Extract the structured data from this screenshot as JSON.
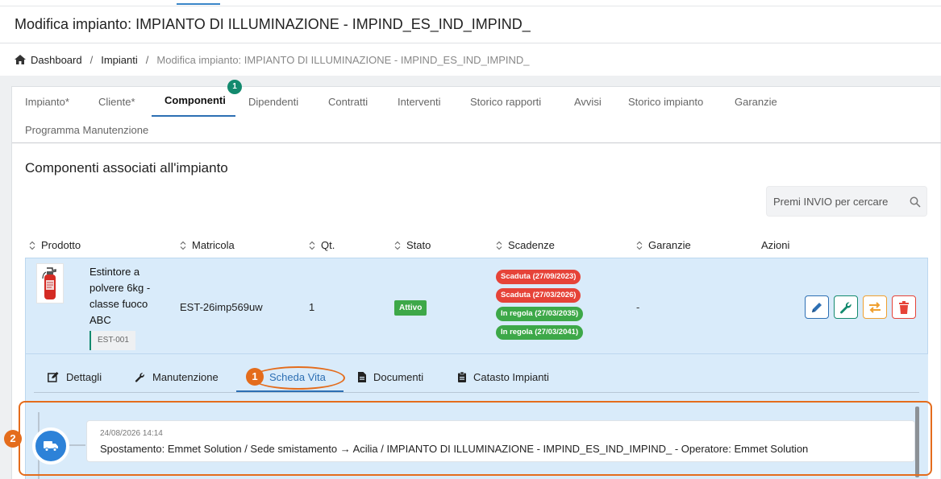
{
  "page": {
    "title": "Modifica impianto: IMPIANTO DI ILLUMINAZIONE - IMPIND_ES_IND_IMPIND_"
  },
  "breadcrumb": {
    "home": "Dashboard",
    "section": "Impianti",
    "current": "Modifica impianto: IMPIANTO DI ILLUMINAZIONE - IMPIND_ES_IND_IMPIND_",
    "separator": "/"
  },
  "tabs": [
    {
      "label": "Impianto*"
    },
    {
      "label": "Cliente*"
    },
    {
      "label": "Componenti",
      "active": true,
      "badge": "1"
    },
    {
      "label": "Dipendenti"
    },
    {
      "label": "Contratti"
    },
    {
      "label": "Interventi"
    },
    {
      "label": "Storico rapporti"
    },
    {
      "label": "Avvisi"
    },
    {
      "label": "Storico impianto"
    },
    {
      "label": "Garanzie"
    },
    {
      "label": "Programma Manutenzione"
    }
  ],
  "section": {
    "title": "Componenti associati all'impianto"
  },
  "search": {
    "placeholder": "Premi INVIO per cercare"
  },
  "table": {
    "columns": [
      "Prodotto",
      "Matricola",
      "Qt.",
      "Stato",
      "Scadenze",
      "Garanzie",
      "Azioni"
    ],
    "row": {
      "product_name": "Estintore a polvere 6kg - classe fuoco ABC",
      "sku": "EST-001",
      "matricola": "EST-26imp569uw",
      "qty": "1",
      "status": "Attivo",
      "deadlines": [
        {
          "label": "Scaduta (27/09/2023)",
          "color": "#e64338"
        },
        {
          "label": "Scaduta (27/03/2026)",
          "color": "#e64338"
        },
        {
          "label": "In regola (27/03/2035)",
          "color": "#3da848"
        },
        {
          "label": "In regola (27/03/2041)",
          "color": "#3da848"
        }
      ],
      "warranty": "-",
      "actions": [
        {
          "icon": "pencil-icon",
          "color": "#2d6fb3"
        },
        {
          "icon": "wrench-icon",
          "color": "#138a6e"
        },
        {
          "icon": "transfer-icon",
          "color": "#f0a030"
        },
        {
          "icon": "trash-icon",
          "color": "#e64338"
        }
      ]
    }
  },
  "subtabs": [
    {
      "label": "Dettagli",
      "icon": "edit-icon"
    },
    {
      "label": "Manutenzione",
      "icon": "wrench-icon"
    },
    {
      "label": "Scheda Vita",
      "active": true
    },
    {
      "label": "Documenti",
      "icon": "document-icon"
    },
    {
      "label": "Catasto Impianti",
      "icon": "clipboard-icon"
    }
  ],
  "timeline": {
    "event_date": "24/08/2026 14:14",
    "event_text": "Spostamento: Emmet Solution / Sede smistamento → Acilia / IMPIANTO DI ILLUMINAZIONE - IMPIND_ES_IND_IMPIND_ - Operatore: Emmet Solution",
    "icon": "truck-icon"
  },
  "annotations": {
    "marker_1": "1",
    "marker_2": "2",
    "color": "#e46c1c"
  },
  "colors": {
    "accent_blue": "#2d6fb3",
    "teal": "#138a6e",
    "row_highlight": "#d9ebfa"
  }
}
